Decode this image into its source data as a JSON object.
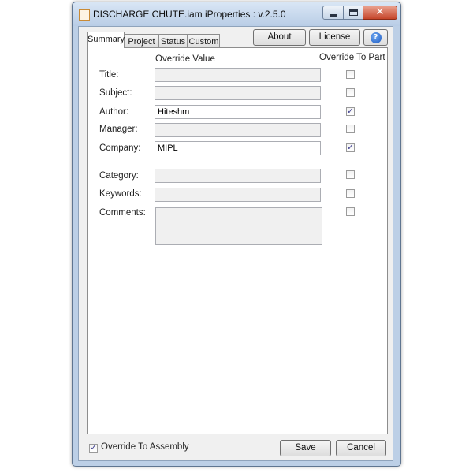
{
  "window": {
    "title": "DISCHARGE CHUTE.iam iProperties : v.2.5.0"
  },
  "tabs": [
    {
      "label": "Summary",
      "active": true
    },
    {
      "label": "Project",
      "active": false
    },
    {
      "label": "Status",
      "active": false
    },
    {
      "label": "Custom",
      "active": false
    }
  ],
  "toolbar": {
    "about_label": "About",
    "license_label": "License",
    "help_icon": "help-icon",
    "help_glyph": "?"
  },
  "columns": {
    "override_value": "Override Value",
    "override_to_part": "Override To Part"
  },
  "fields": [
    {
      "label": "Title:",
      "value": "",
      "enabled": false,
      "override": false
    },
    {
      "label": "Subject:",
      "value": "",
      "enabled": false,
      "override": false
    },
    {
      "label": "Author:",
      "value": "Hiteshm",
      "enabled": true,
      "override": true
    },
    {
      "label": "Manager:",
      "value": "",
      "enabled": false,
      "override": false
    },
    {
      "label": "Company:",
      "value": "MIPL",
      "enabled": true,
      "override": true
    },
    {
      "label": "Category:",
      "value": "",
      "enabled": false,
      "override": false
    },
    {
      "label": "Keywords:",
      "value": "",
      "enabled": false,
      "override": false
    },
    {
      "label": "Comments:",
      "value": "",
      "enabled": false,
      "override": false
    }
  ],
  "footer": {
    "override_to_assembly_label": "Override To Assembly",
    "override_to_assembly_checked": true,
    "save_label": "Save",
    "cancel_label": "Cancel"
  },
  "colors": {
    "title_bar": "#c9daf0",
    "close_button": "#c74a2e",
    "help_button": "#1d5bc4"
  }
}
